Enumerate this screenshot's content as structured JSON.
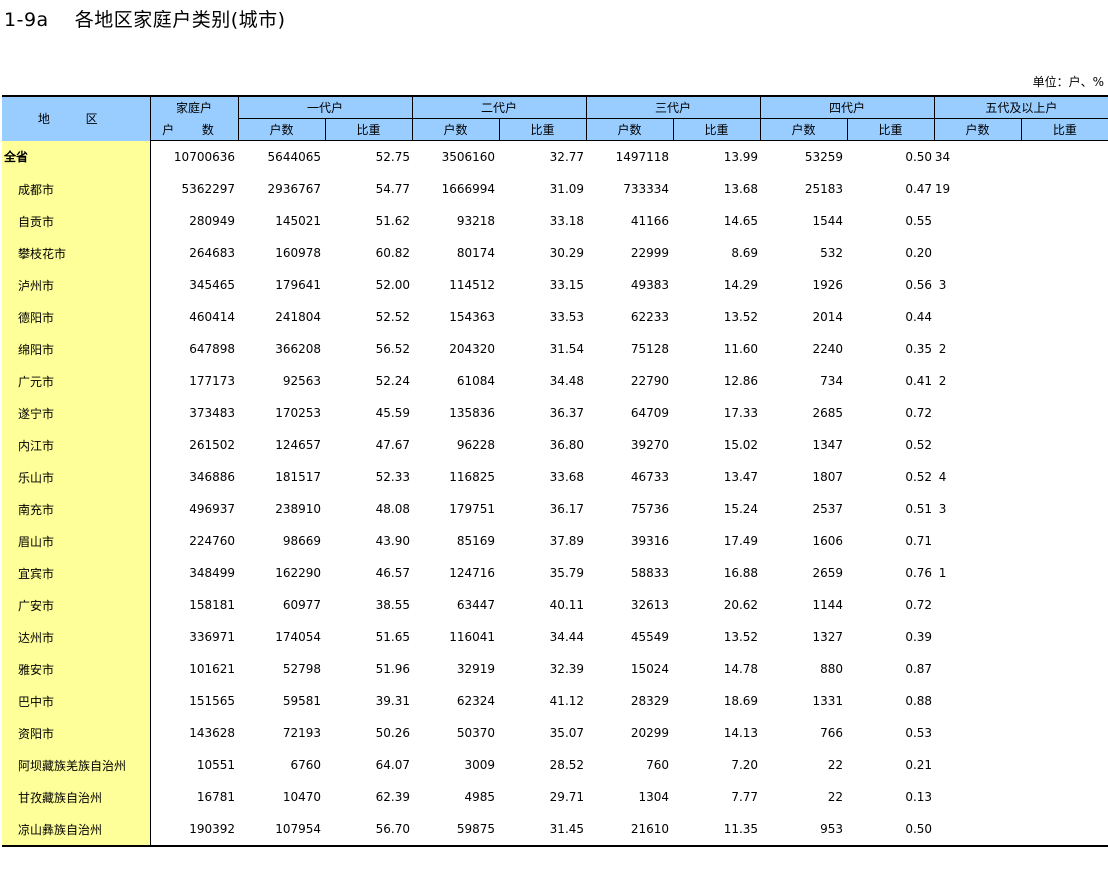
{
  "title": {
    "code": "1-9a",
    "text": "各地区家庭户类别(城市)"
  },
  "unit": "单位：户、%",
  "header": {
    "region": "地 区",
    "total_top": "家庭户",
    "total_bottom": "户 数",
    "groups": [
      "一代户",
      "二代户",
      "三代户",
      "四代户",
      "五代及以上户"
    ],
    "sub": [
      "户数",
      "比重"
    ]
  },
  "rows": [
    {
      "region": "全省",
      "total": "10700636",
      "g1": "5644065",
      "p1": "52.75",
      "g2": "3506160",
      "p2": "32.77",
      "g3": "1497118",
      "p3": "13.99",
      "g4": "53259",
      "p4": "0.50",
      "g5": "34",
      "p5": ""
    },
    {
      "region": "成都市",
      "total": "5362297",
      "g1": "2936767",
      "p1": "54.77",
      "g2": "1666994",
      "p2": "31.09",
      "g3": "733334",
      "p3": "13.68",
      "g4": "25183",
      "p4": "0.47",
      "g5": "19",
      "p5": ""
    },
    {
      "region": "自贡市",
      "total": "280949",
      "g1": "145021",
      "p1": "51.62",
      "g2": "93218",
      "p2": "33.18",
      "g3": "41166",
      "p3": "14.65",
      "g4": "1544",
      "p4": "0.55",
      "g5": "",
      "p5": ""
    },
    {
      "region": "攀枝花市",
      "total": "264683",
      "g1": "160978",
      "p1": "60.82",
      "g2": "80174",
      "p2": "30.29",
      "g3": "22999",
      "p3": "8.69",
      "g4": "532",
      "p4": "0.20",
      "g5": "",
      "p5": ""
    },
    {
      "region": "泸州市",
      "total": "345465",
      "g1": "179641",
      "p1": "52.00",
      "g2": "114512",
      "p2": "33.15",
      "g3": "49383",
      "p3": "14.29",
      "g4": "1926",
      "p4": "0.56",
      "g5": "3",
      "p5": ""
    },
    {
      "region": "德阳市",
      "total": "460414",
      "g1": "241804",
      "p1": "52.52",
      "g2": "154363",
      "p2": "33.53",
      "g3": "62233",
      "p3": "13.52",
      "g4": "2014",
      "p4": "0.44",
      "g5": "",
      "p5": ""
    },
    {
      "region": "绵阳市",
      "total": "647898",
      "g1": "366208",
      "p1": "56.52",
      "g2": "204320",
      "p2": "31.54",
      "g3": "75128",
      "p3": "11.60",
      "g4": "2240",
      "p4": "0.35",
      "g5": "2",
      "p5": ""
    },
    {
      "region": "广元市",
      "total": "177173",
      "g1": "92563",
      "p1": "52.24",
      "g2": "61084",
      "p2": "34.48",
      "g3": "22790",
      "p3": "12.86",
      "g4": "734",
      "p4": "0.41",
      "g5": "2",
      "p5": ""
    },
    {
      "region": "遂宁市",
      "total": "373483",
      "g1": "170253",
      "p1": "45.59",
      "g2": "135836",
      "p2": "36.37",
      "g3": "64709",
      "p3": "17.33",
      "g4": "2685",
      "p4": "0.72",
      "g5": "",
      "p5": ""
    },
    {
      "region": "内江市",
      "total": "261502",
      "g1": "124657",
      "p1": "47.67",
      "g2": "96228",
      "p2": "36.80",
      "g3": "39270",
      "p3": "15.02",
      "g4": "1347",
      "p4": "0.52",
      "g5": "",
      "p5": ""
    },
    {
      "region": "乐山市",
      "total": "346886",
      "g1": "181517",
      "p1": "52.33",
      "g2": "116825",
      "p2": "33.68",
      "g3": "46733",
      "p3": "13.47",
      "g4": "1807",
      "p4": "0.52",
      "g5": "4",
      "p5": ""
    },
    {
      "region": "南充市",
      "total": "496937",
      "g1": "238910",
      "p1": "48.08",
      "g2": "179751",
      "p2": "36.17",
      "g3": "75736",
      "p3": "15.24",
      "g4": "2537",
      "p4": "0.51",
      "g5": "3",
      "p5": ""
    },
    {
      "region": "眉山市",
      "total": "224760",
      "g1": "98669",
      "p1": "43.90",
      "g2": "85169",
      "p2": "37.89",
      "g3": "39316",
      "p3": "17.49",
      "g4": "1606",
      "p4": "0.71",
      "g5": "",
      "p5": ""
    },
    {
      "region": "宜宾市",
      "total": "348499",
      "g1": "162290",
      "p1": "46.57",
      "g2": "124716",
      "p2": "35.79",
      "g3": "58833",
      "p3": "16.88",
      "g4": "2659",
      "p4": "0.76",
      "g5": "1",
      "p5": ""
    },
    {
      "region": "广安市",
      "total": "158181",
      "g1": "60977",
      "p1": "38.55",
      "g2": "63447",
      "p2": "40.11",
      "g3": "32613",
      "p3": "20.62",
      "g4": "1144",
      "p4": "0.72",
      "g5": "",
      "p5": ""
    },
    {
      "region": "达州市",
      "total": "336971",
      "g1": "174054",
      "p1": "51.65",
      "g2": "116041",
      "p2": "34.44",
      "g3": "45549",
      "p3": "13.52",
      "g4": "1327",
      "p4": "0.39",
      "g5": "",
      "p5": ""
    },
    {
      "region": "雅安市",
      "total": "101621",
      "g1": "52798",
      "p1": "51.96",
      "g2": "32919",
      "p2": "32.39",
      "g3": "15024",
      "p3": "14.78",
      "g4": "880",
      "p4": "0.87",
      "g5": "",
      "p5": ""
    },
    {
      "region": "巴中市",
      "total": "151565",
      "g1": "59581",
      "p1": "39.31",
      "g2": "62324",
      "p2": "41.12",
      "g3": "28329",
      "p3": "18.69",
      "g4": "1331",
      "p4": "0.88",
      "g5": "",
      "p5": ""
    },
    {
      "region": "资阳市",
      "total": "143628",
      "g1": "72193",
      "p1": "50.26",
      "g2": "50370",
      "p2": "35.07",
      "g3": "20299",
      "p3": "14.13",
      "g4": "766",
      "p4": "0.53",
      "g5": "",
      "p5": ""
    },
    {
      "region": "阿坝藏族羌族自治州",
      "total": "10551",
      "g1": "6760",
      "p1": "64.07",
      "g2": "3009",
      "p2": "28.52",
      "g3": "760",
      "p3": "7.20",
      "g4": "22",
      "p4": "0.21",
      "g5": "",
      "p5": ""
    },
    {
      "region": "甘孜藏族自治州",
      "total": "16781",
      "g1": "10470",
      "p1": "62.39",
      "g2": "4985",
      "p2": "29.71",
      "g3": "1304",
      "p3": "7.77",
      "g4": "22",
      "p4": "0.13",
      "g5": "",
      "p5": ""
    },
    {
      "region": "凉山彝族自治州",
      "total": "190392",
      "g1": "107954",
      "p1": "56.70",
      "g2": "59875",
      "p2": "31.45",
      "g3": "21610",
      "p3": "11.35",
      "g4": "953",
      "p4": "0.50",
      "g5": "",
      "p5": ""
    }
  ]
}
